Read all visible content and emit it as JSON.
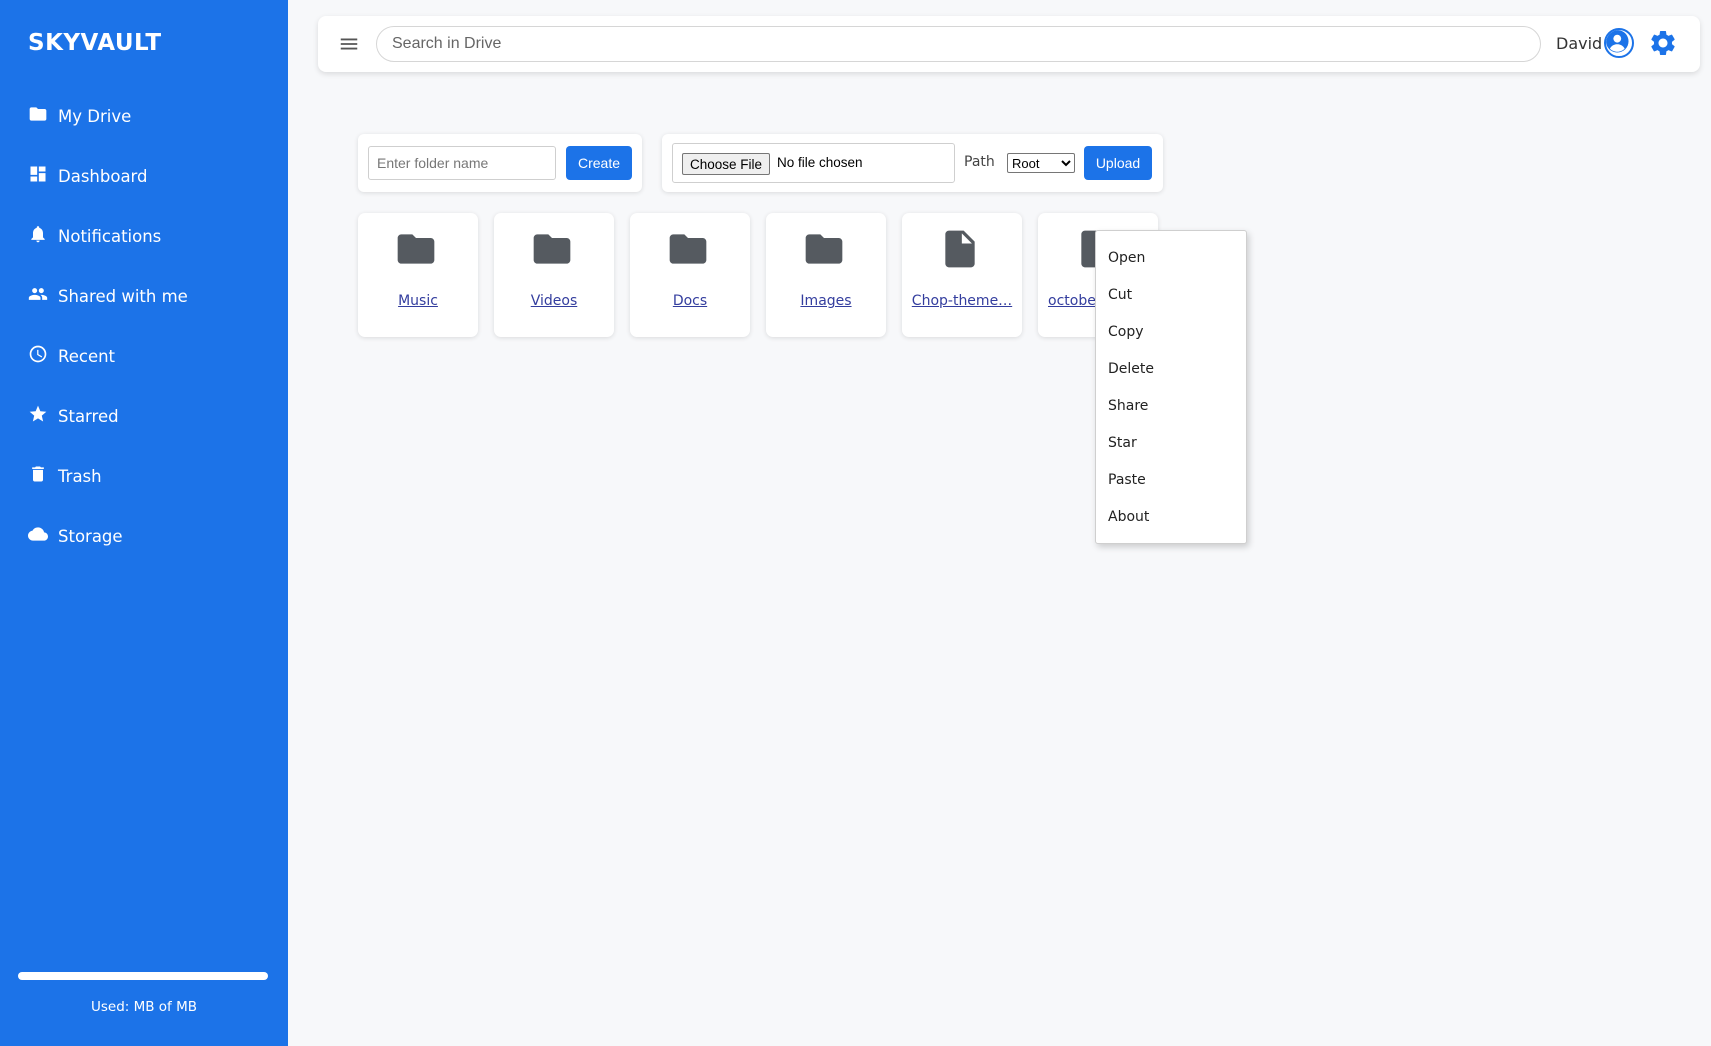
{
  "brand": "SKYVAULT",
  "sidebar": {
    "items": [
      {
        "label": "My Drive",
        "icon": "folder-icon"
      },
      {
        "label": "Dashboard",
        "icon": "dashboard-icon"
      },
      {
        "label": "Notifications",
        "icon": "bell-icon"
      },
      {
        "label": "Shared with me",
        "icon": "people-icon"
      },
      {
        "label": "Recent",
        "icon": "clock-icon"
      },
      {
        "label": "Starred",
        "icon": "star-icon"
      },
      {
        "label": "Trash",
        "icon": "trash-icon"
      },
      {
        "label": "Storage",
        "icon": "cloud-icon"
      }
    ],
    "storage_text": "Used: MB of MB",
    "storage_used_fraction": 0
  },
  "header": {
    "search_placeholder": "Search in Drive",
    "user_name": "David"
  },
  "folder_form": {
    "placeholder": "Enter folder name",
    "create_label": "Create"
  },
  "upload_form": {
    "choose_label": "Choose File",
    "no_file_text": "No file chosen",
    "path_label": "Path",
    "path_selected": "Root",
    "upload_label": "Upload"
  },
  "items": [
    {
      "name": "Music",
      "type": "folder"
    },
    {
      "name": "Videos",
      "type": "folder"
    },
    {
      "name": "Docs",
      "type": "folder"
    },
    {
      "name": "Images",
      "type": "folder"
    },
    {
      "name": "Chop-theme…",
      "type": "file"
    },
    {
      "name": "octobe",
      "type": "file"
    }
  ],
  "context_menu": [
    "Open",
    "Cut",
    "Copy",
    "Delete",
    "Share",
    "Star",
    "Paste",
    "About"
  ],
  "colors": {
    "accent": "#1c73e8",
    "item_icon": "#555a60",
    "link": "#333d9e"
  }
}
